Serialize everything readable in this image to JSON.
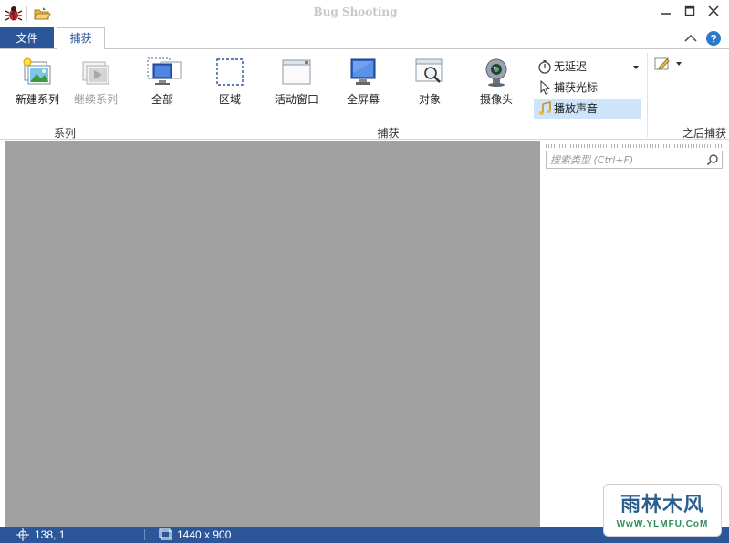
{
  "window": {
    "title": "Bug Shooting"
  },
  "tabs": {
    "file": "文件",
    "capture": "捕获"
  },
  "ribbon": {
    "series_group": {
      "label": "系列",
      "new_series": "新建系列",
      "continue_series": "继续系列"
    },
    "capture_group": {
      "label": "捕获",
      "all": "全部",
      "region": "区域",
      "active_window": "活动窗口",
      "fullscreen": "全屏幕",
      "object": "对象",
      "webcam": "摄像头",
      "no_delay": "无延迟",
      "capture_cursor": "捕获光标",
      "play_sound": "播放声音"
    },
    "after_capture_group": {
      "label": "之后捕获"
    }
  },
  "search": {
    "placeholder": "搜索类型 (Ctrl+F)"
  },
  "status": {
    "cursor_position": "138, 1",
    "screen_size": "1440 x 900"
  },
  "watermark": {
    "title": "雨林木风",
    "url": "WwW.YLMFU.CoM"
  },
  "colors": {
    "accent": "#2b579a",
    "canvas": "#a1a1a1",
    "selected": "#cde4fb"
  }
}
